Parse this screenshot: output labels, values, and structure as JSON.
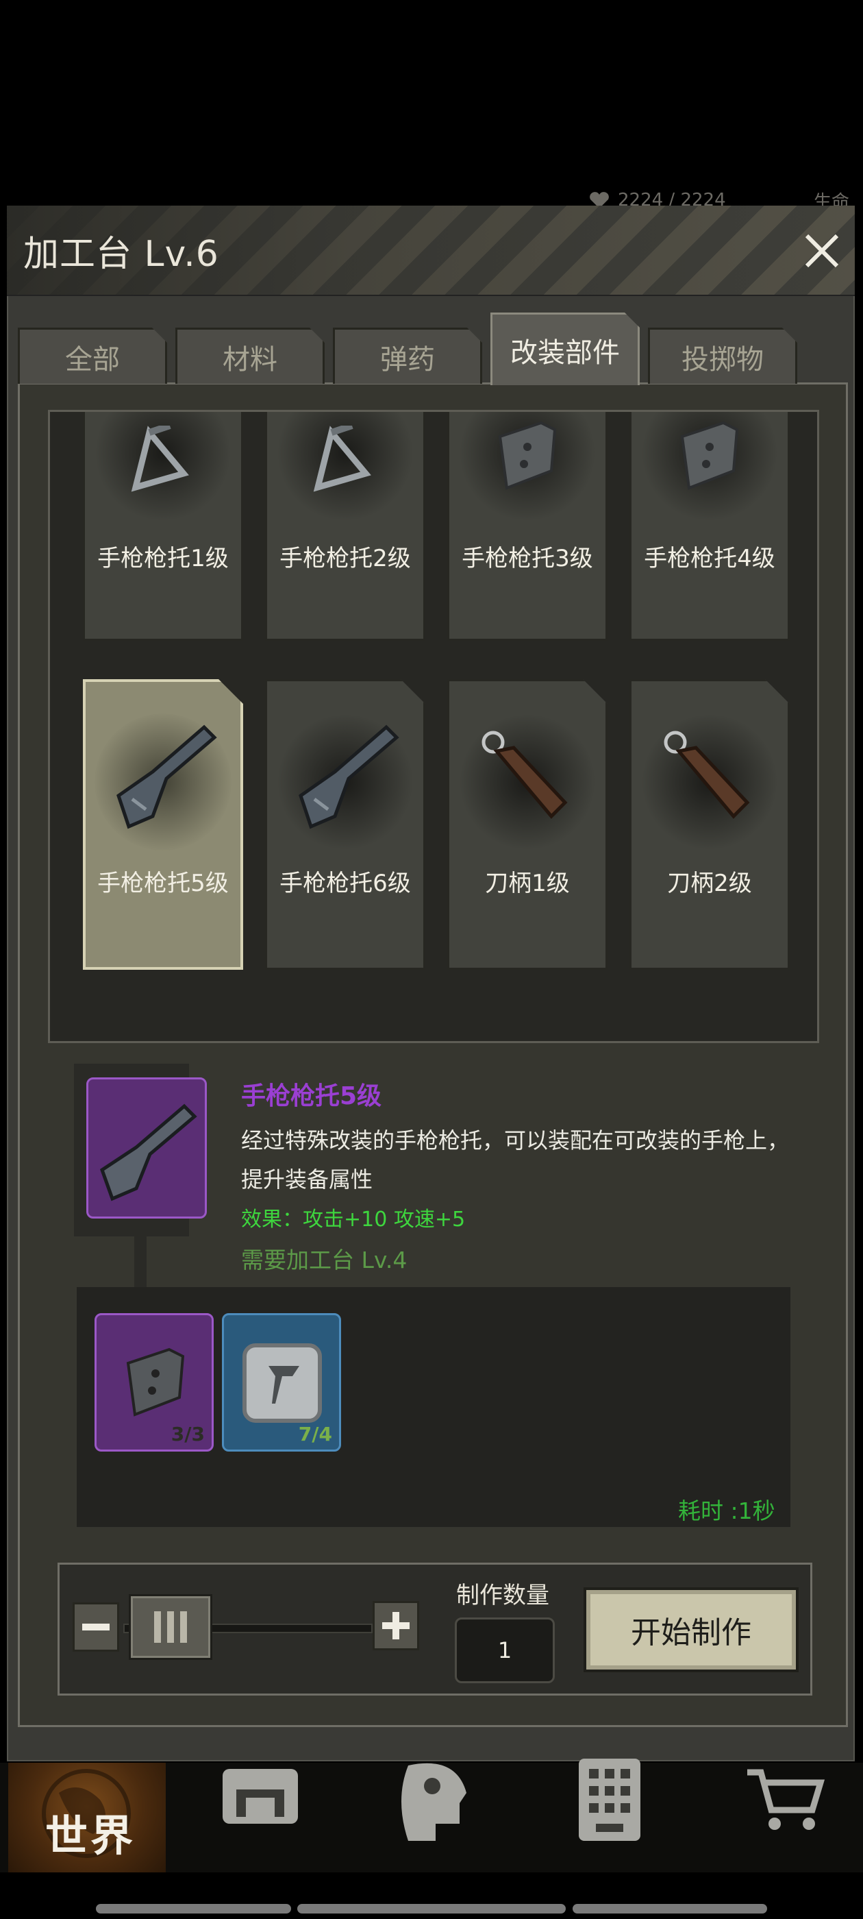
{
  "top_stats": {
    "health": "2224 / 2224",
    "label": "生命"
  },
  "window": {
    "title": "加工台 Lv.6"
  },
  "tabs": [
    {
      "label": "全部",
      "active": false
    },
    {
      "label": "材料",
      "active": false
    },
    {
      "label": "弹药",
      "active": false
    },
    {
      "label": "改装部件",
      "active": true
    },
    {
      "label": "投掷物",
      "active": false
    }
  ],
  "items": [
    {
      "name": "手枪枪托1级",
      "icon": "tripod-stock-icon"
    },
    {
      "name": "手枪枪托2级",
      "icon": "tripod-stock-icon"
    },
    {
      "name": "手枪枪托3级",
      "icon": "plate-stock-icon"
    },
    {
      "name": "手枪枪托4级",
      "icon": "plate-stock-icon"
    },
    {
      "name": "手枪枪托5级",
      "icon": "pistol-stock-icon",
      "selected": true
    },
    {
      "name": "手枪枪托6级",
      "icon": "pistol-stock-icon"
    },
    {
      "name": "刀柄1级",
      "icon": "knife-handle-icon"
    },
    {
      "name": "刀柄2级",
      "icon": "knife-handle-icon"
    }
  ],
  "detail": {
    "name": "手枪枪托5级",
    "description": "经过特殊改装的手枪枪托，可以装配在可改装的手枪上，提升装备属性",
    "effect": "效果：攻击+10  攻速+5",
    "requirement": "需要加工台 Lv.4",
    "materials": [
      {
        "icon": "plate-stock-icon",
        "count": "3/3",
        "color": "#5a2e74"
      },
      {
        "icon": "anvil-icon",
        "count": "7/4",
        "color": "#2a5a7c"
      }
    ],
    "time": "耗时 :1秒"
  },
  "controls": {
    "qty_label": "制作数量",
    "qty_value": "1",
    "start_label": "开始制作"
  },
  "bottom_nav": [
    {
      "label": "世界",
      "icon": "globe-icon"
    },
    {
      "icon": "backpack-icon"
    },
    {
      "icon": "skills-head-icon"
    },
    {
      "icon": "building-icon"
    },
    {
      "icon": "cart-icon"
    }
  ],
  "colors": {
    "rarity_purple": "#9a3fd2",
    "effect_green": "#3ed63e",
    "time_green": "#33b33a"
  }
}
